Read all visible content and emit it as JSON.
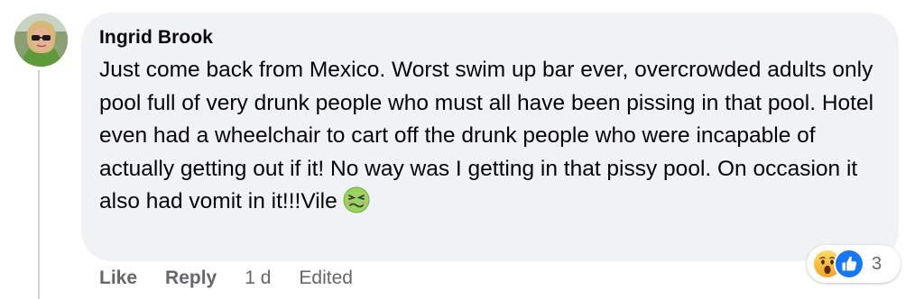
{
  "comment": {
    "author": "Ingrid Brook",
    "text": "Just come back from Mexico. Worst swim up bar ever, overcrowded adults only pool full of very drunk people who must all have been pissing in that pool. Hotel even had a wheelchair to cart off the drunk people who were incapable of actually getting out if it! No way was I getting in that pissy pool. On occasion it also had vomit in it!!!Vile",
    "emoji": "nauseated-face-emoji"
  },
  "actions": {
    "like_label": "Like",
    "reply_label": "Reply",
    "time": "1 d",
    "edited_label": "Edited"
  },
  "reactions": {
    "icons": [
      "wow-reaction-icon",
      "like-reaction-icon"
    ],
    "count": "3"
  },
  "colors": {
    "bubble_bg": "#f0f2f5",
    "secondary_text": "#65676b",
    "like_blue": "#1877f2",
    "wow_yellow": "#f7b125"
  }
}
